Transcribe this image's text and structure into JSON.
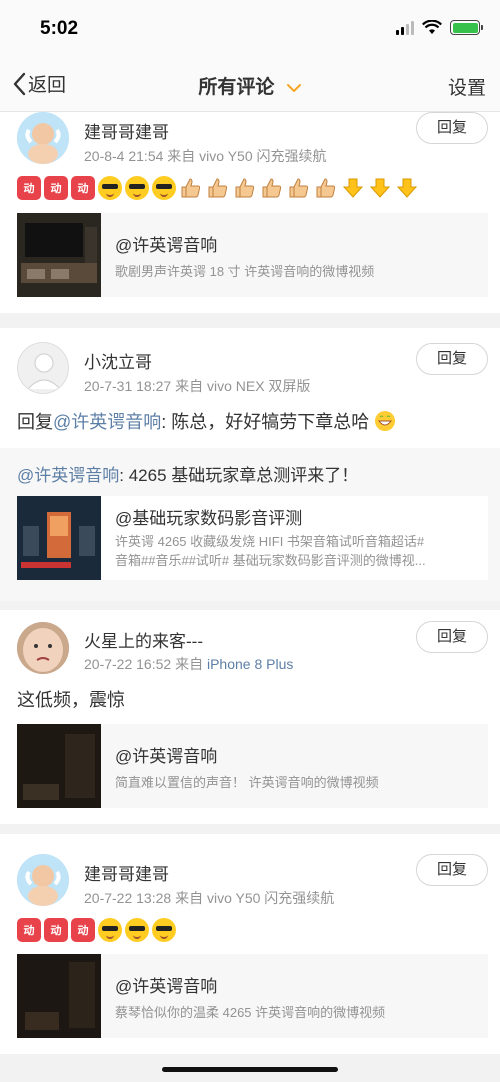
{
  "status_bar": {
    "time": "5:02",
    "battery_level": 1.0,
    "battery_color": "#36c14a"
  },
  "nav": {
    "back_label": "返回",
    "title": "所有评论",
    "settings_label": "设置",
    "accent": "#f5a623"
  },
  "comments": [
    {
      "user": "建哥哥建哥",
      "meta": "20-8-4 21:54  来自 vivo Y50 闪充强续航",
      "reply_label": "回复",
      "emojis": [
        "dong",
        "dong",
        "dong",
        "cool",
        "cool",
        "cool",
        "good",
        "good",
        "good",
        "good",
        "good",
        "good",
        "arrow",
        "arrow",
        "arrow"
      ],
      "video": {
        "title": "@许英谔音响",
        "desc": "歌剧男声许英谔 18 寸   许英谔音响的微博视频"
      }
    },
    {
      "user": "小沈立哥",
      "meta": "20-7-31 18:27  来自 vivo NEX 双屏版",
      "reply_label": "回复",
      "text_prefix": "回复",
      "text_link": "@许英谔音响",
      "text_body": ": 陈总，好好犒劳下章总哈",
      "quote_link": "@许英谔音响",
      "quote_body": ": 4265 基础玩家章总测评来了！",
      "video": {
        "title": "@基础玩家数码影音评测",
        "desc_line1": "许英谔 4265 收藏级发烧 HIFI 书架音箱试听音箱超话#",
        "desc_line2": "音箱##音乐##试听# 基础玩家数码影音评测的微博视..."
      }
    },
    {
      "user": "火星上的来客---",
      "meta_prefix": "20-7-22 16:52  来自 ",
      "meta_device": "iPhone 8 Plus",
      "reply_label": "回复",
      "text": "这低频，震惊",
      "video": {
        "title": "@许英谔音响",
        "desc": "简直难以置信的声音！   许英谔音响的微博视频"
      }
    },
    {
      "user": "建哥哥建哥",
      "meta": "20-7-22 13:28  来自 vivo Y50 闪充强续航",
      "reply_label": "回复",
      "emojis": [
        "dong",
        "dong",
        "dong",
        "cool",
        "cool",
        "cool"
      ],
      "video": {
        "title": "@许英谔音响",
        "desc": "蔡琴恰似你的温柔 4265  许英谔音响的微博视频"
      }
    }
  ],
  "emoji_text": {
    "dong": "动"
  }
}
